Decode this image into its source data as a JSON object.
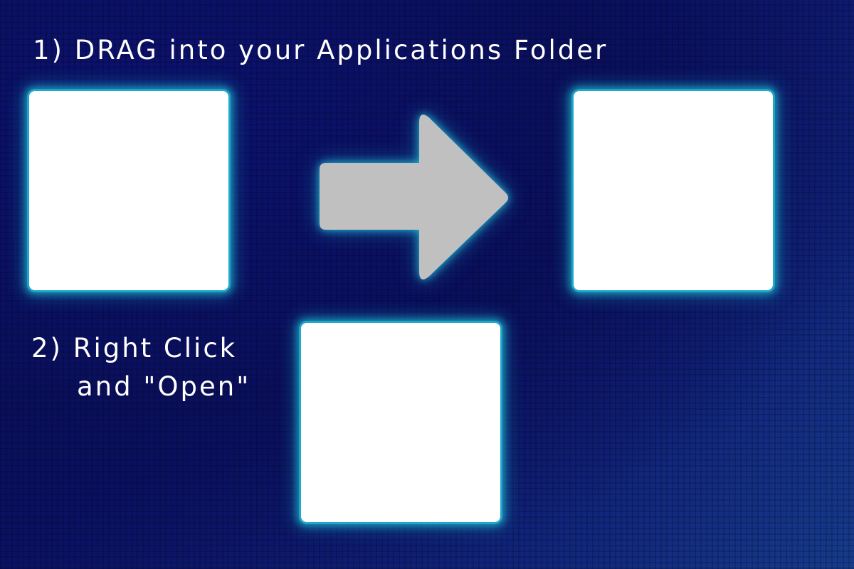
{
  "instructions": {
    "step1": "1) DRAG into your Applications Folder",
    "step2_line1": "2) Right Click",
    "step2_line2": "and \"Open\""
  },
  "icons": {
    "app": "app-icon",
    "drag_arrow": "arrow-right-icon",
    "applications_folder": "applications-folder-icon",
    "app_open": "app-icon"
  },
  "colors": {
    "background": "#0b1166",
    "glow": "#28c8e1",
    "arrow": "#c0c0c0",
    "text": "#ffffff"
  }
}
